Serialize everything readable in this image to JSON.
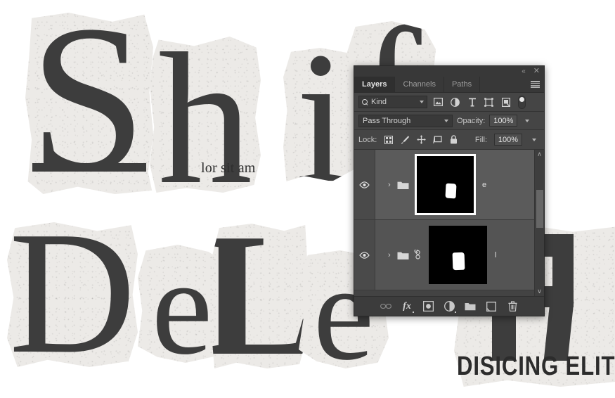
{
  "artwork": {
    "letters": [
      {
        "id": "S",
        "char": "S"
      },
      {
        "id": "h",
        "char": "h"
      },
      {
        "id": "i",
        "char": "i"
      },
      {
        "id": "f",
        "char": "f"
      },
      {
        "id": "D",
        "char": "D"
      },
      {
        "id": "e1",
        "char": "e"
      },
      {
        "id": "L",
        "char": "L"
      },
      {
        "id": "e2",
        "char": "e"
      }
    ],
    "word_top": "Shif",
    "word_bottom": "DeLe",
    "microtext": "lor sit am",
    "block_caption": "DISICING ELIT"
  },
  "panel": {
    "titlebar": {
      "collapse_label": "«",
      "close_label": "✕"
    },
    "tabs": [
      {
        "label": "Layers",
        "active": true
      },
      {
        "label": "Channels",
        "active": false
      },
      {
        "label": "Paths",
        "active": false
      }
    ],
    "filter": {
      "kind_label": "Kind",
      "icons": [
        "pixel-filter-icon",
        "adjustment-filter-icon",
        "type-filter-icon",
        "shape-filter-icon",
        "smart-object-filter-icon"
      ],
      "toggle_name": "filter-enable-toggle"
    },
    "blend": {
      "mode": "Pass Through",
      "opacity_label": "Opacity:",
      "opacity_value": "100%"
    },
    "lock": {
      "label": "Lock:",
      "icons": [
        "lock-transparent-pixels-icon",
        "lock-image-pixels-icon",
        "lock-position-icon",
        "lock-artboard-icon",
        "lock-all-icon"
      ],
      "fill_label": "Fill:",
      "fill_value": "100%"
    },
    "layers": [
      {
        "name": "e",
        "visible": true,
        "selected": true,
        "expanded": false,
        "linked": false,
        "chevron": "›",
        "thumb_framed": true
      },
      {
        "name": "l",
        "visible": true,
        "selected": false,
        "expanded": false,
        "linked": true,
        "chevron": "›",
        "thumb_framed": false
      }
    ],
    "scrollbar": {
      "up_label": "∧",
      "down_label": "∨"
    },
    "bottom_toolbar": [
      {
        "name": "link-layers-button",
        "label": "⚭"
      },
      {
        "name": "layer-style-fx-button",
        "label": "fx"
      },
      {
        "name": "add-layer-mask-button",
        "label": ""
      },
      {
        "name": "adjustment-layer-button",
        "label": ""
      },
      {
        "name": "new-group-button",
        "label": ""
      },
      {
        "name": "new-layer-button",
        "label": ""
      },
      {
        "name": "delete-layer-button",
        "label": ""
      }
    ]
  },
  "colors": {
    "panel_bg": "#383838",
    "row_bg": "#454545",
    "list_bg": "#434343",
    "layer_row": "#545454",
    "layer_row_selected": "#5b5b5b",
    "text": "#c8c8c8",
    "ink": "#3d3d3d",
    "paper": "#eceae7"
  }
}
